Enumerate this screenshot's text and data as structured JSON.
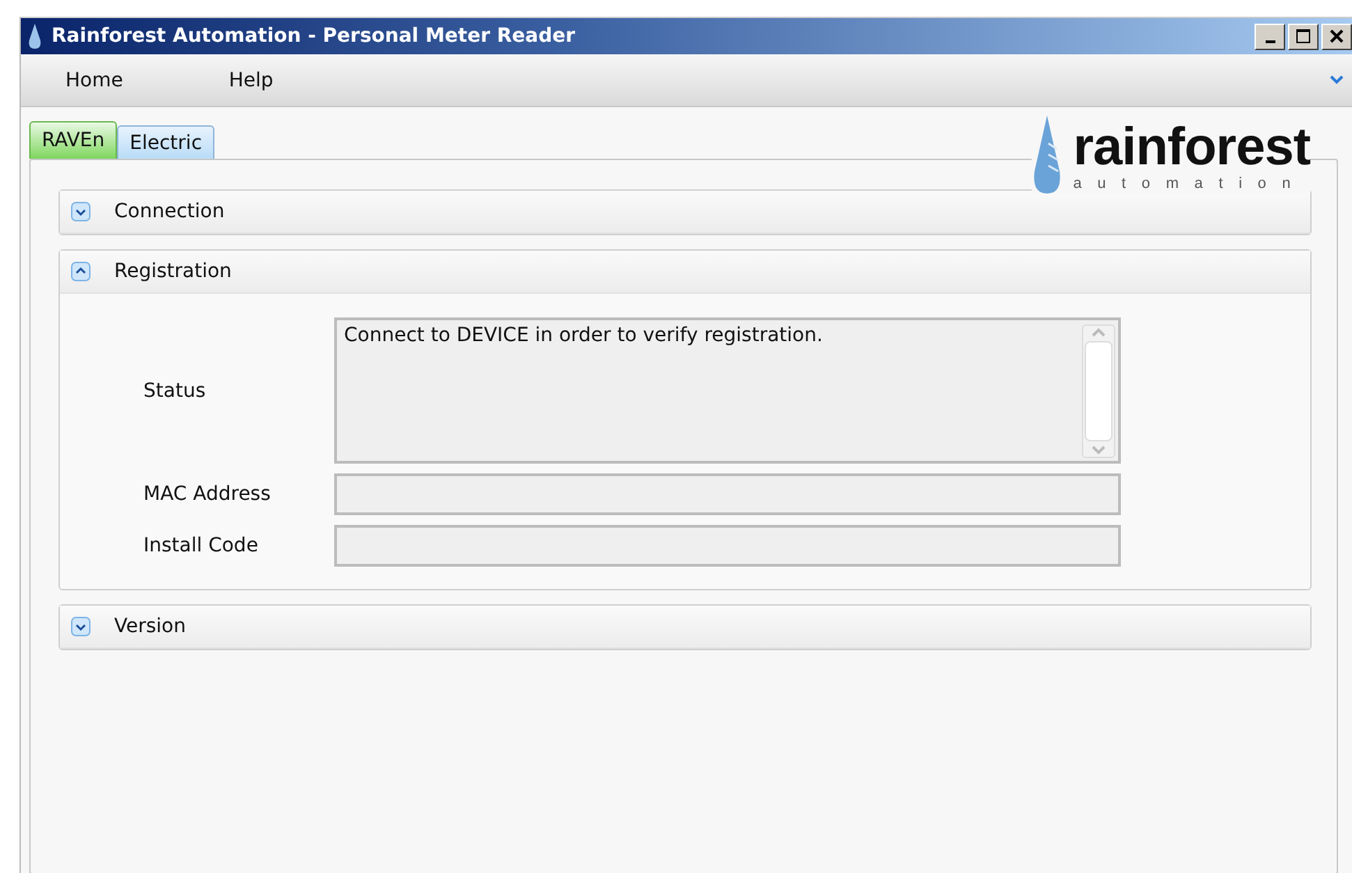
{
  "window": {
    "title": "Rainforest Automation - Personal Meter Reader"
  },
  "menu": [
    {
      "label": "Home"
    },
    {
      "label": "Help"
    }
  ],
  "tabs": [
    {
      "label": "RAVEn",
      "selected": true
    },
    {
      "label": "Electric",
      "selected": false
    }
  ],
  "logo": {
    "name": "rainforest",
    "tagline": "automation"
  },
  "sections": [
    {
      "title": "Connection",
      "expanded": false
    },
    {
      "title": "Registration",
      "expanded": true,
      "fields": [
        {
          "kind": "textarea",
          "label": "Status",
          "value": "Connect to DEVICE in order to verify registration."
        },
        {
          "kind": "input",
          "label": "MAC Address"
        },
        {
          "kind": "input",
          "label": "Install Code"
        }
      ]
    },
    {
      "title": "Version",
      "expanded": false
    }
  ]
}
